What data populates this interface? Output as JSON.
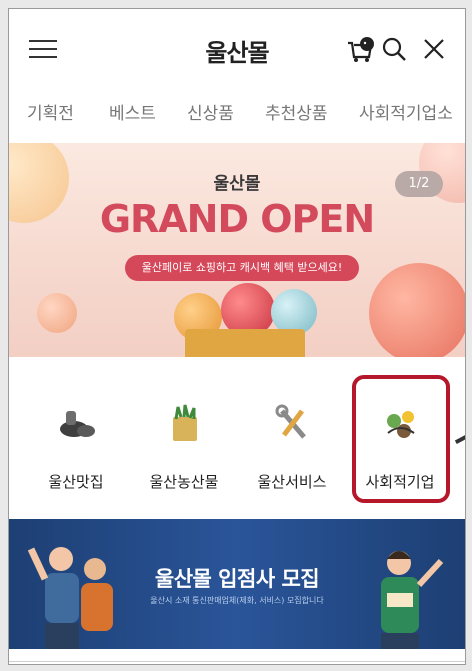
{
  "header": {
    "logo": "울산몰",
    "icons": [
      "menu-icon",
      "cart-icon",
      "search-icon",
      "close-icon"
    ]
  },
  "nav": {
    "items": [
      "기획전",
      "베스트",
      "신상품",
      "추천상품",
      "사회적기업소"
    ]
  },
  "banner": {
    "title": "울산몰",
    "headline": "GRAND OPEN",
    "pill_text": "울산페이로 쇼핑하고 캐시백 혜택 받으세요!",
    "page_indicator": "1/2",
    "accent_color": "#d24a5c"
  },
  "categories": [
    {
      "label": "울산맛집",
      "icon": "food-icon"
    },
    {
      "label": "울산농산물",
      "icon": "produce-icon"
    },
    {
      "label": "울산서비스",
      "icon": "tools-icon"
    },
    {
      "label": "사회적기업",
      "icon": "social-enterprise-icon"
    }
  ],
  "highlight_color": "#b5172b",
  "recruit": {
    "title": "울산몰 입점사 모집",
    "subtitle": "울산시 소재 통신판매업체(제화, 서비스) 모집합니다"
  }
}
